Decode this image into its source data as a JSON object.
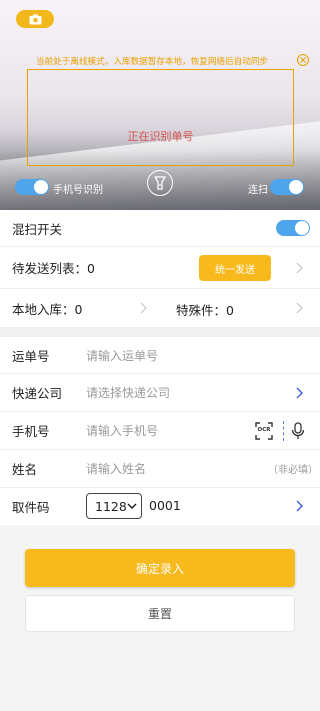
{
  "camera": {
    "offline_notice": "当前处于离线模式，入库数据暂存本地，恢复网络后自动同步",
    "scan_status": "正在识别单号",
    "phone_ocr_toggle": {
      "label": "手机号识别",
      "on": true
    },
    "continuous_toggle": {
      "label": "连扫",
      "on": true
    }
  },
  "settings": {
    "mixed_scan": {
      "label": "混扫开关",
      "on": true
    },
    "pending_list_label": "待发送列表：0",
    "send_all_button": "统一发送",
    "local_inbound_label": "本地入库：0",
    "special_label": "特殊件：0"
  },
  "form": {
    "waybill": {
      "label": "运单号",
      "placeholder": "请输入运单号"
    },
    "courier": {
      "label": "快递公司",
      "placeholder": "请选择快递公司"
    },
    "phone": {
      "label": "手机号",
      "placeholder": "请输入手机号",
      "ocr_text": "OCR"
    },
    "name": {
      "label": "姓名",
      "placeholder": "请输入姓名",
      "hint": "（非必填）"
    },
    "pickup_code": {
      "label": "取件码",
      "prefix": "1128",
      "suffix": "0001"
    }
  },
  "actions": {
    "confirm": "确定录入",
    "reset": "重置"
  },
  "colors": {
    "accent": "#f7b91b",
    "switch": "#4ea5ec",
    "link": "#3a5bd9",
    "alert": "#d9534f"
  }
}
